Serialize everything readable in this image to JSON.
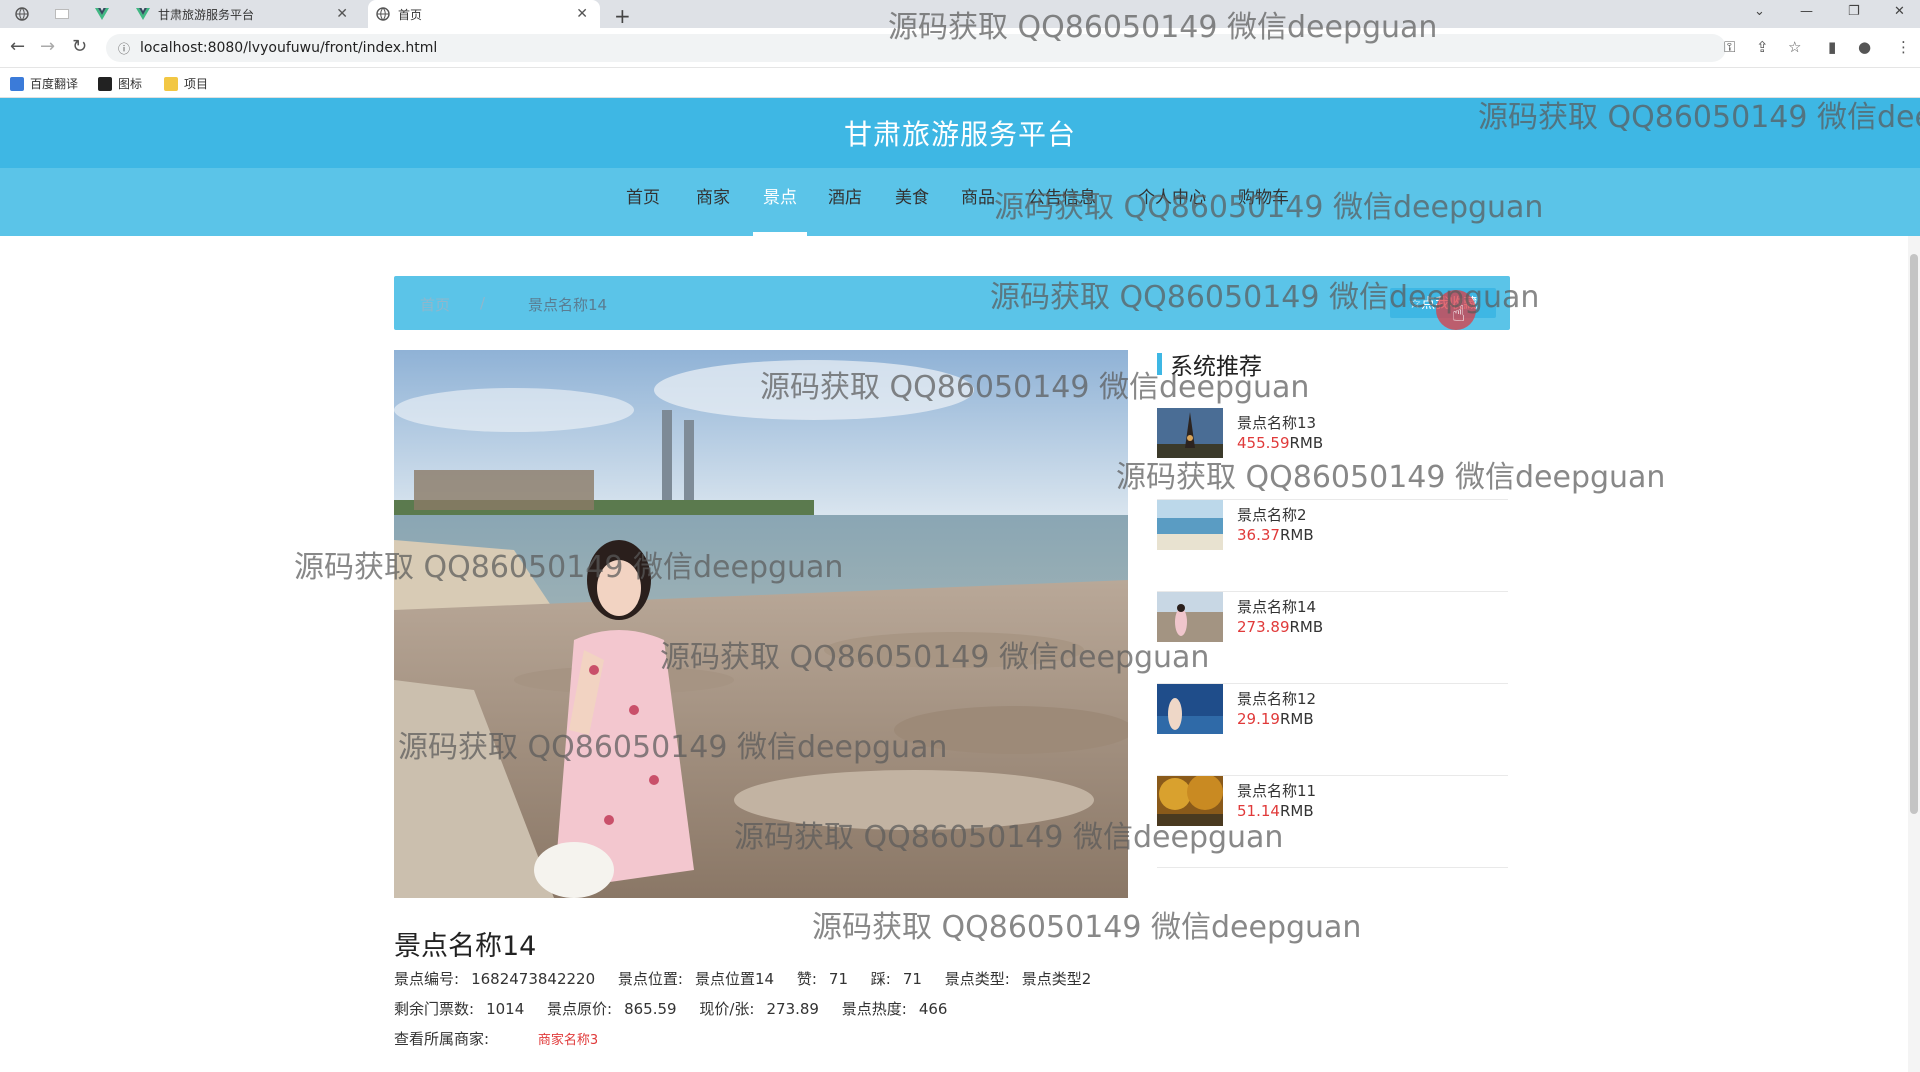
{
  "browser": {
    "tabs": [
      {
        "title": "甘肃旅游服务平台"
      },
      {
        "title": "首页"
      }
    ],
    "url": "localhost:8080/lvyoufuwu/front/index.html",
    "bookmarks": [
      "百度翻译",
      "图标",
      "项目"
    ]
  },
  "site": {
    "title": "甘肃旅游服务平台",
    "nav": [
      "首页",
      "商家",
      "景点",
      "酒店",
      "美食",
      "商品",
      "公告信息",
      "个人中心",
      "购物车"
    ],
    "active_nav": "景点"
  },
  "breadcrumb": {
    "home": "首页",
    "sep": "/",
    "current": "景点名称14",
    "collect_button": "☆点我收藏"
  },
  "recommend": {
    "heading": "系统推荐",
    "price_unit": "RMB",
    "items": [
      {
        "name": "景点名称13",
        "price": "455.59"
      },
      {
        "name": "景点名称2",
        "price": "36.37"
      },
      {
        "name": "景点名称14",
        "price": "273.89"
      },
      {
        "name": "景点名称12",
        "price": "29.19"
      },
      {
        "name": "景点名称11",
        "price": "51.14"
      }
    ]
  },
  "detail": {
    "title": "景点名称14",
    "line1": [
      {
        "label": "景点编号:",
        "value": "1682473842220"
      },
      {
        "label": "景点位置:",
        "value": "景点位置14"
      },
      {
        "label": "赞:",
        "value": "71"
      },
      {
        "label": "踩:",
        "value": "71"
      },
      {
        "label": "景点类型:",
        "value": "景点类型2"
      }
    ],
    "line2": [
      {
        "label": "剩余门票数:",
        "value": "1014"
      },
      {
        "label": "景点原价:",
        "value": "865.59"
      },
      {
        "label": "现价/张:",
        "value": "273.89"
      },
      {
        "label": "景点热度:",
        "value": "466"
      }
    ],
    "merchant_label": "查看所属商家:",
    "merchant_link": "商家名称3"
  },
  "watermark": "源码获取 QQ86050149 微信deepguan",
  "colors": {
    "header": "#3eb7e4",
    "nav": "#5bc4e8",
    "price": "#e03a3a"
  }
}
